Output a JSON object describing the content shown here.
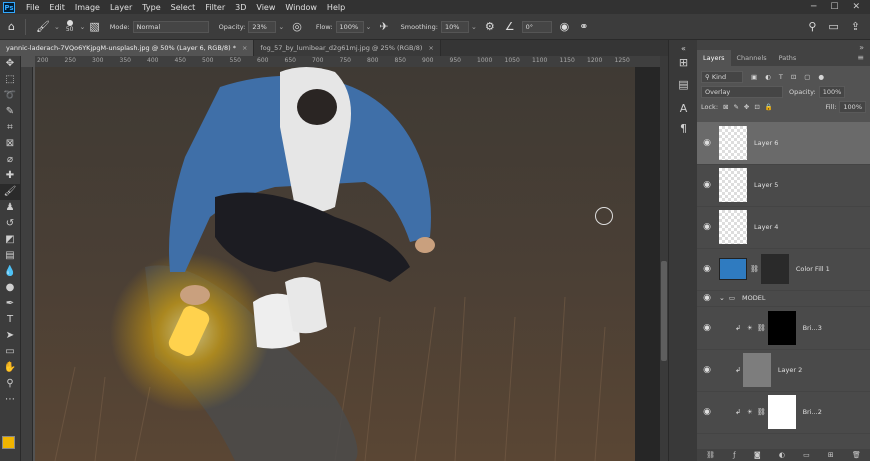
{
  "menubar": {
    "app_logo": "Ps",
    "items": [
      "File",
      "Edit",
      "Image",
      "Layer",
      "Type",
      "Select",
      "Filter",
      "3D",
      "View",
      "Window",
      "Help"
    ]
  },
  "options": {
    "brush_size": "50",
    "mode_label": "Mode:",
    "mode_value": "Normal",
    "opacity_label": "Opacity:",
    "opacity_value": "23%",
    "flow_label": "Flow:",
    "flow_value": "100%",
    "smoothing_label": "Smoothing:",
    "smoothing_value": "10%",
    "angle_value": "0°"
  },
  "tabs": [
    {
      "label": "yannic-laderach-7VQo6YKjpgM-unsplash.jpg @ 50% (Layer 6, RGB/8) *",
      "active": true
    },
    {
      "label": "fog_57_by_lumibear_d2g61mj.jpg @ 25% (RGB/8)",
      "active": false
    }
  ],
  "ruler": {
    "h_labels": [
      "200",
      "250",
      "300",
      "350",
      "400",
      "450",
      "500",
      "550",
      "600",
      "650",
      "700",
      "750",
      "800",
      "850",
      "900",
      "950",
      "1000",
      "1050",
      "1100",
      "1150",
      "1200",
      "1250"
    ]
  },
  "panel": {
    "tabs": [
      "Layers",
      "Channels",
      "Paths"
    ],
    "kind_label": "Kind",
    "blend_mode": "Overlay",
    "opacity_label": "Opacity:",
    "opacity_value": "100%",
    "lock_label": "Lock:",
    "fill_label": "Fill:",
    "fill_value": "100%"
  },
  "layers": [
    {
      "name": "Layer 6",
      "type": "pixel",
      "selected": true
    },
    {
      "name": "Layer 5",
      "type": "pixel"
    },
    {
      "name": "Layer 4",
      "type": "pixel"
    },
    {
      "name": "Color Fill 1",
      "type": "fill"
    },
    {
      "name": "MODEL",
      "type": "group"
    },
    {
      "name": "Bri...3",
      "type": "adjustment"
    },
    {
      "name": "Layer 2",
      "type": "pixel-clipped"
    },
    {
      "name": "Bri...2",
      "type": "adjustment"
    }
  ],
  "colors": {
    "foreground": "#f0b400",
    "background": "#ffffff",
    "accent": "#31a8ff"
  }
}
